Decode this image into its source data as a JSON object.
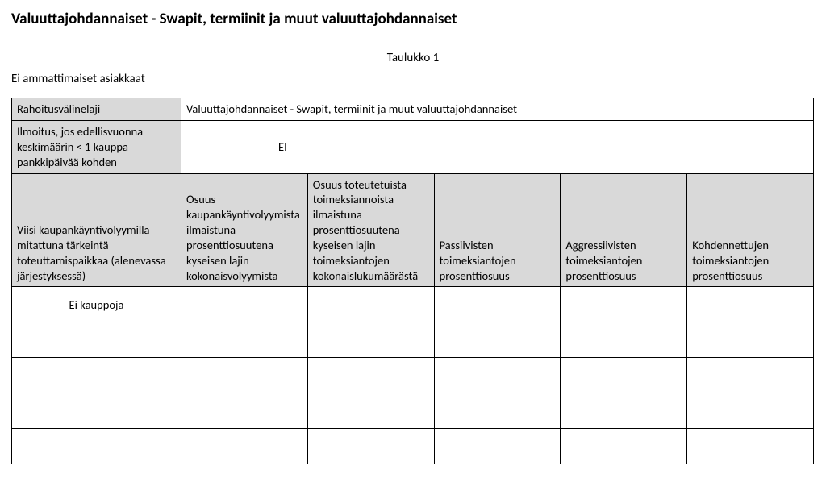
{
  "title": "Valuuttajohdannaiset - Swapit, termiinit ja muut valuuttajohdannaiset",
  "table_label": "Taulukko 1",
  "subtitle": "Ei ammattimaiset asiakkaat",
  "info_rows": [
    {
      "label": "Rahoitusvälinelaji",
      "value": "Valuuttajohdannaiset - Swapit, termiinit ja muut valuuttajohdannaiset"
    },
    {
      "label": "Ilmoitus, jos edellisvuonna keskimäärin < 1 kauppa pankkipäivää kohden",
      "value": "EI"
    }
  ],
  "columns": [
    "Viisi kaupankäyntivolyymilla mitattuna tärkeintä toteuttamispaikkaa (alenevassa järjestyksessä)",
    "Osuus kaupankäyntivolyymista ilmaistuna prosenttiosuutena kyseisen lajin kokonaisvolyymista",
    "Osuus toteutetuista toimeksiannoista ilmaistuna prosenttiosuutena kyseisen lajin toimeksiantojen kokonaislukumäärästä",
    "Passiivisten toimeksiantojen prosenttiosuus",
    "Aggressiivisten toimeksiantojen prosenttiosuus",
    "Kohdennettujen toimeksiantojen prosenttiosuus"
  ],
  "rows": [
    [
      "Ei kauppoja",
      "",
      "",
      "",
      "",
      ""
    ],
    [
      "",
      "",
      "",
      "",
      "",
      ""
    ],
    [
      "",
      "",
      "",
      "",
      "",
      ""
    ],
    [
      "",
      "",
      "",
      "",
      "",
      ""
    ],
    [
      "",
      "",
      "",
      "",
      "",
      ""
    ]
  ]
}
